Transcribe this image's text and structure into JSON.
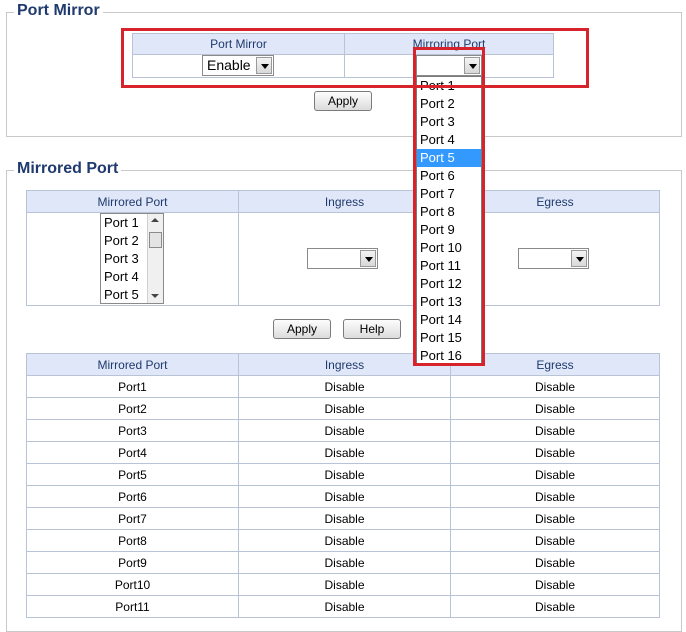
{
  "port_mirror": {
    "title": "Port Mirror",
    "col_port_mirror": "Port Mirror",
    "col_mirroring_port": "Mirroring Port",
    "port_mirror_value": "Enable",
    "mirroring_port_value": "",
    "apply_label": "Apply",
    "dropdown_options": [
      "Port 1",
      "Port 2",
      "Port 3",
      "Port 4",
      "Port 5",
      "Port 6",
      "Port 7",
      "Port 8",
      "Port 9",
      "Port 10",
      "Port 11",
      "Port 12",
      "Port 13",
      "Port 14",
      "Port 15",
      "Port 16"
    ],
    "dropdown_selected": "Port 5"
  },
  "mirrored_port": {
    "title": "Mirrored Port",
    "col_mirrored_port": "Mirrored Port",
    "col_ingress": "Ingress",
    "col_egress": "Egress",
    "list_items": [
      "Port 1",
      "Port 2",
      "Port 3",
      "Port 4",
      "Port 5"
    ],
    "ingress_value": "",
    "egress_value": "",
    "apply_label": "Apply",
    "help_label": "Help"
  },
  "status_table": {
    "headers": [
      "Mirrored Port",
      "Ingress",
      "Egress"
    ],
    "rows": [
      [
        "Port1",
        "Disable",
        "Disable"
      ],
      [
        "Port2",
        "Disable",
        "Disable"
      ],
      [
        "Port3",
        "Disable",
        "Disable"
      ],
      [
        "Port4",
        "Disable",
        "Disable"
      ],
      [
        "Port5",
        "Disable",
        "Disable"
      ],
      [
        "Port6",
        "Disable",
        "Disable"
      ],
      [
        "Port7",
        "Disable",
        "Disable"
      ],
      [
        "Port8",
        "Disable",
        "Disable"
      ],
      [
        "Port9",
        "Disable",
        "Disable"
      ],
      [
        "Port10",
        "Disable",
        "Disable"
      ],
      [
        "Port11",
        "Disable",
        "Disable"
      ]
    ]
  },
  "colors": {
    "header_bg": "#dfe7f8",
    "title_color": "#1f3a6e",
    "highlight": "#d7232b",
    "selection": "#3399ff"
  }
}
